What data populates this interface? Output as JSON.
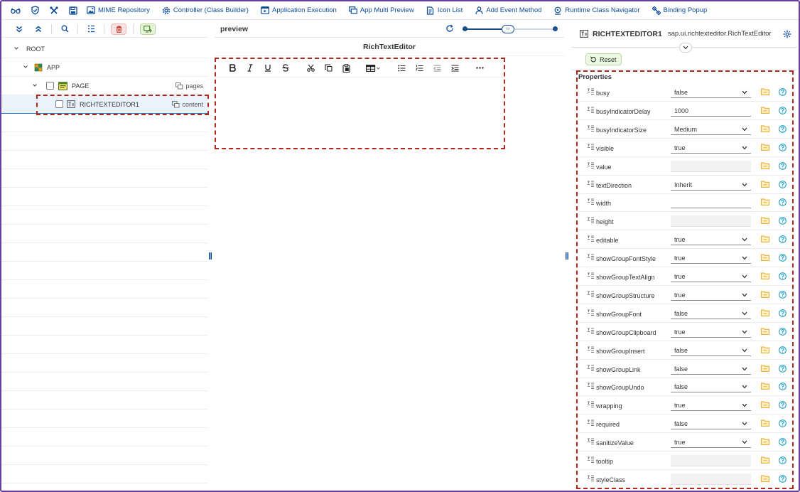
{
  "toolbar": {
    "items": [
      {
        "label": "MIME Repository",
        "icon": "image-icon"
      },
      {
        "label": "Controller (Class Builder)",
        "icon": "gear-icon"
      },
      {
        "label": "Application Execution",
        "icon": "run-window-icon"
      },
      {
        "label": "App Multi Preview",
        "icon": "screens-icon"
      },
      {
        "label": "Icon List",
        "icon": "icon-list-icon"
      },
      {
        "label": "Add Event Method",
        "icon": "event-person-icon"
      },
      {
        "label": "Runtime Class Navigator",
        "icon": "navigator-icon"
      },
      {
        "label": "Binding Popup",
        "icon": "binding-icon"
      }
    ]
  },
  "tree": {
    "nodes": [
      {
        "label": "ROOT",
        "aggregation": ""
      },
      {
        "label": "APP",
        "aggregation": ""
      },
      {
        "label": "PAGE",
        "aggregation": "pages"
      },
      {
        "label": "RICHTEXTEDITOR1",
        "aggregation": "content"
      }
    ]
  },
  "preview": {
    "title": "preview",
    "editor_title": "RichTextEditor"
  },
  "inspector": {
    "control_name": "RICHTEXTEDITOR1",
    "control_type": "sap.ui.richtexteditor.RichTextEditor",
    "reset_label": "Reset",
    "properties_title": "Properties",
    "properties": [
      {
        "name": "busy",
        "value": "false",
        "kind": "select"
      },
      {
        "name": "busyIndicatorDelay",
        "value": "1000",
        "kind": "input"
      },
      {
        "name": "busyIndicatorSize",
        "value": "Medium",
        "kind": "select"
      },
      {
        "name": "visible",
        "value": "true",
        "kind": "select"
      },
      {
        "name": "value",
        "value": "",
        "kind": "empty"
      },
      {
        "name": "textDirection",
        "value": "Inherit",
        "kind": "select"
      },
      {
        "name": "width",
        "value": "",
        "kind": "input"
      },
      {
        "name": "height",
        "value": "",
        "kind": "empty"
      },
      {
        "name": "editable",
        "value": "true",
        "kind": "select"
      },
      {
        "name": "showGroupFontStyle",
        "value": "true",
        "kind": "select"
      },
      {
        "name": "showGroupTextAlign",
        "value": "true",
        "kind": "select"
      },
      {
        "name": "showGroupStructure",
        "value": "true",
        "kind": "select"
      },
      {
        "name": "showGroupFont",
        "value": "false",
        "kind": "select"
      },
      {
        "name": "showGroupClipboard",
        "value": "true",
        "kind": "select"
      },
      {
        "name": "showGroupInsert",
        "value": "false",
        "kind": "select"
      },
      {
        "name": "showGroupLink",
        "value": "false",
        "kind": "select"
      },
      {
        "name": "showGroupUndo",
        "value": "false",
        "kind": "select"
      },
      {
        "name": "wrapping",
        "value": "true",
        "kind": "select"
      },
      {
        "name": "required",
        "value": "false",
        "kind": "select"
      },
      {
        "name": "sanitizeValue",
        "value": "true",
        "kind": "select"
      },
      {
        "name": "tooltip",
        "value": "",
        "kind": "empty"
      },
      {
        "name": "styleClass",
        "value": "",
        "kind": "empty"
      }
    ]
  },
  "colors": {
    "accent": "#0a4c9b",
    "highlight_dash": "#b3261e",
    "frame": "#6b3fa0"
  }
}
